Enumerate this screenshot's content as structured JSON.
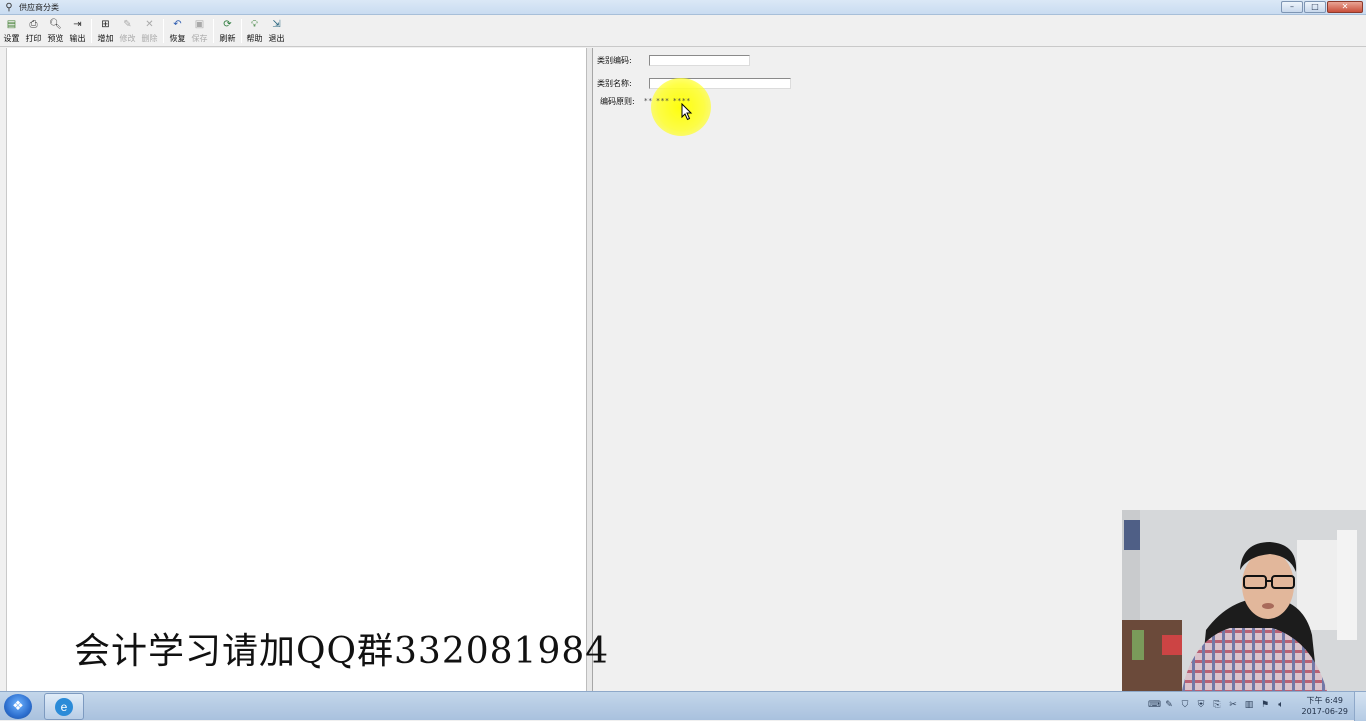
{
  "window": {
    "title": "供应商分类",
    "buttons": {
      "minimize": "–",
      "maximize": "□",
      "close": "✕"
    }
  },
  "toolbar": {
    "items": [
      {
        "label": "设置",
        "icon": "settings-icon",
        "enabled": true
      },
      {
        "label": "打印",
        "icon": "print-icon",
        "enabled": true
      },
      {
        "label": "预览",
        "icon": "preview-icon",
        "enabled": true
      },
      {
        "label": "输出",
        "icon": "export-icon",
        "enabled": true
      },
      {
        "label": "增加",
        "icon": "add-icon",
        "enabled": true
      },
      {
        "label": "修改",
        "icon": "edit-icon",
        "enabled": false
      },
      {
        "label": "删除",
        "icon": "delete-icon",
        "enabled": false
      },
      {
        "label": "恢复",
        "icon": "undo-icon",
        "enabled": true
      },
      {
        "label": "保存",
        "icon": "save-icon",
        "enabled": false
      },
      {
        "label": "刷新",
        "icon": "refresh-icon",
        "enabled": true
      },
      {
        "label": "帮助",
        "icon": "help-icon",
        "enabled": true
      },
      {
        "label": "退出",
        "icon": "exit-icon",
        "enabled": true
      }
    ]
  },
  "form": {
    "code_label": "类别编码:",
    "code_value": "",
    "name_label": "类别名称:",
    "name_value": "",
    "rule_label": "编码原则:",
    "rule_value": "** *** ****"
  },
  "watermark": "会计学习请加QQ群332081984",
  "taskbar": {
    "time": "下午 6:49",
    "date": "2017-06-29"
  }
}
